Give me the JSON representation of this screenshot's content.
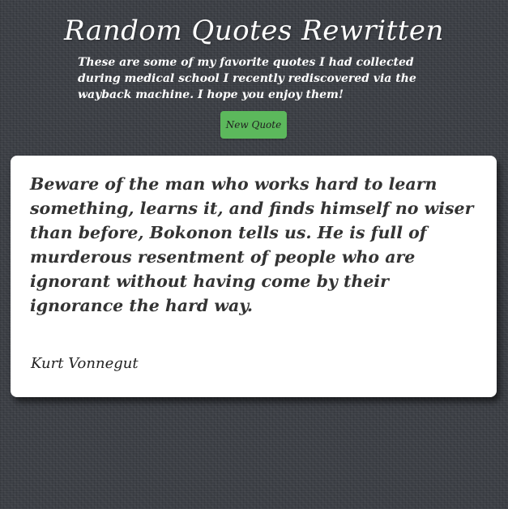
{
  "header": {
    "title": "Random Quotes Rewritten",
    "intro": "These are some of my favorite quotes I had collected during medical school I recently rediscovered via the wayback machine. I hope you enjoy them!",
    "new_quote_label": "New Quote"
  },
  "quote": {
    "text": "Beware of the man who works hard to learn something, learns it, and finds himself no wiser than before, Bokonon tells us. He is full of murderous resentment of people who are ignorant without having come by their ignorance the hard way.",
    "author": "Kurt Vonnegut"
  },
  "colors": {
    "background": "#3c3f45",
    "button": "#5cb85c",
    "card": "#ffffff",
    "quote_text": "#333333"
  }
}
